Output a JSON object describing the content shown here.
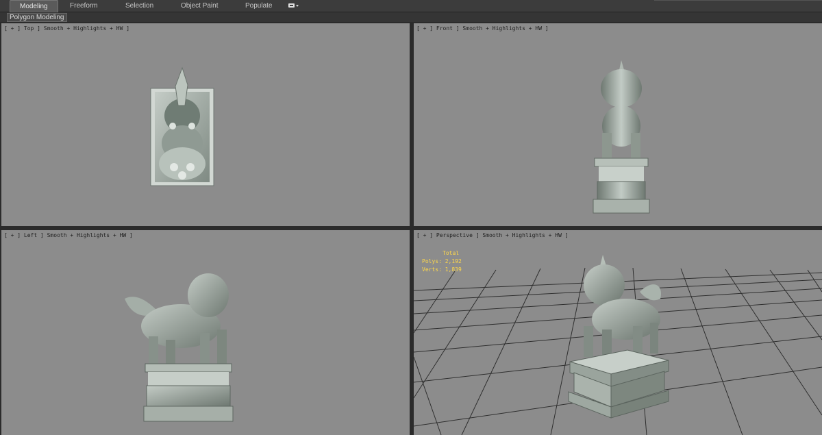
{
  "ribbon": {
    "tabs": [
      {
        "label": "Modeling",
        "active": true
      },
      {
        "label": "Freeform",
        "active": false
      },
      {
        "label": "Selection",
        "active": false
      },
      {
        "label": "Object Paint",
        "active": false
      },
      {
        "label": "Populate",
        "active": false
      }
    ],
    "options_icon": "ribbon-options-icon"
  },
  "subbar": {
    "label": "Polygon Modeling"
  },
  "viewports": {
    "top": {
      "label": "[ + ] Top ] Smooth + Highlights + HW ]"
    },
    "front": {
      "label": "[ + ] Front ] Smooth + Highlights + HW ]"
    },
    "left": {
      "label": "[ + ] Left ] Smooth + Highlights + HW ]"
    },
    "perspective": {
      "label": "[ + ] Perspective ] Smooth + Highlights + HW ]"
    }
  },
  "stats": {
    "header": "Total",
    "polys_label": "Polys:",
    "polys_value": "2,192",
    "verts_label": "Verts:",
    "verts_value": "1,839"
  },
  "colors": {
    "viewport_bg": "#8c8c8c",
    "stats_text": "#ffd84a",
    "ribbon_bg": "#3c3c3c",
    "statue": "#a8b2ac"
  }
}
